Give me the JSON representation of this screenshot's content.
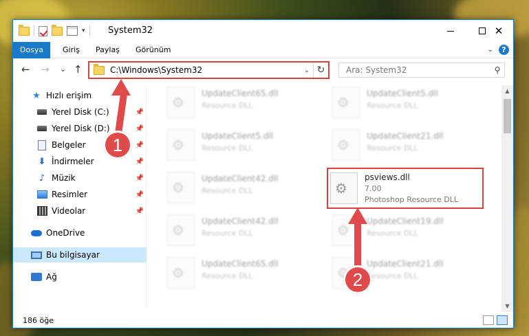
{
  "window": {
    "title": "System32",
    "controls": {
      "minimize": "—",
      "maximize": "☐",
      "close": "✕"
    }
  },
  "ribbon": {
    "tabs": [
      "Dosya",
      "Giriş",
      "Paylaş",
      "Görünüm"
    ],
    "help": "?"
  },
  "nav": {
    "back": "←",
    "forward": "→",
    "recent": "⌄",
    "up": "↑",
    "address": "C:\\Windows\\System32",
    "search_placeholder": "Ara: System32"
  },
  "sidebar": {
    "items": [
      {
        "label": "Hızlı erişim",
        "icon": "star-icon",
        "pinned": false
      },
      {
        "label": "Yerel Disk (C:)",
        "icon": "drive-icon",
        "pinned": true
      },
      {
        "label": "Yerel Disk (D:)",
        "icon": "drive-icon",
        "pinned": true
      },
      {
        "label": "Belgeler",
        "icon": "document-icon",
        "pinned": true
      },
      {
        "label": "İndirmeler",
        "icon": "download-icon",
        "pinned": true
      },
      {
        "label": "Müzik",
        "icon": "music-icon",
        "pinned": true
      },
      {
        "label": "Resimler",
        "icon": "picture-icon",
        "pinned": true
      },
      {
        "label": "Videolar",
        "icon": "video-icon",
        "pinned": true
      },
      {
        "label": "OneDrive",
        "icon": "cloud-icon",
        "pinned": false
      },
      {
        "label": "Bu bilgisayar",
        "icon": "computer-icon",
        "pinned": false,
        "selected": true
      },
      {
        "label": "Ağ",
        "icon": "network-icon",
        "pinned": false
      }
    ]
  },
  "files": {
    "left": [
      {
        "name": "UpdateClient65.dll",
        "type": "Resource DLL"
      },
      {
        "name": "UpdateClient5.dll",
        "type": "Resource DLL"
      },
      {
        "name": "UpdateClient42.dll",
        "type": "Resource DLL"
      },
      {
        "name": "UpdateClient42.dll",
        "type": "Resource DLL"
      },
      {
        "name": "UpdateClient65.dll",
        "type": "Resource DLL"
      }
    ],
    "right": [
      {
        "name": "UpdateClient5.dll",
        "type": "Resource DLL"
      },
      {
        "name": "UpdateClient21.dll",
        "type": "Resource DLL"
      },
      {
        "name": "psviews.dll",
        "version": "7.00",
        "type": "Photoshop Resource DLL",
        "highlight": true
      },
      {
        "name": "UpdateClient19.dll",
        "type": "Resource DLL"
      },
      {
        "name": "UpdateClient21.dll",
        "type": "Resource DLL"
      }
    ]
  },
  "status": {
    "count": "186 öğe"
  },
  "callouts": {
    "step1": "1",
    "step2": "2"
  },
  "colors": {
    "accent": "#1979ca",
    "callout": "#e04a4a",
    "selected": "#cce8ff"
  }
}
